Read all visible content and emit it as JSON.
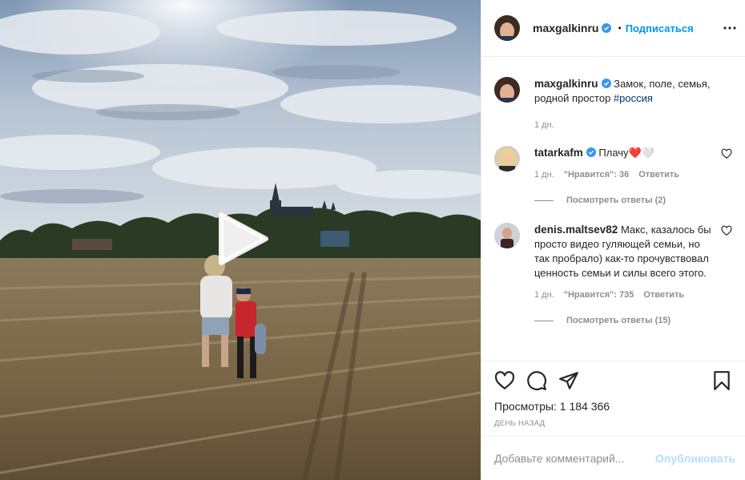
{
  "post": {
    "author": "maxgalkinru",
    "follow_label": "Подписаться",
    "dot": "•",
    "caption_text": "Замок, поле, семья, родной простор",
    "caption_hashtag": "#россия",
    "caption_age": "1 дн."
  },
  "comments": [
    {
      "user": "tatarkafm",
      "text": "Плачу❤️🤍",
      "age": "1 дн.",
      "likes_label": "\"Нравится\": 36",
      "reply_label": "Ответить",
      "view_replies": "Посмотреть ответы (2)"
    },
    {
      "user": "denis.maltsev82",
      "text": "Макс, казалось бы просто видео гуляющей семьи, но так пробрало) как-то прочувствовал ценность семьи и силы всего этого.",
      "age": "1 дн.",
      "likes_label": "\"Нравится\": 735",
      "reply_label": "Ответить",
      "view_replies": "Посмотреть ответы (15)"
    }
  ],
  "stats": {
    "views_label": "Просмотры: 1 184 366",
    "date": "ДЕНЬ НАЗАД"
  },
  "add_comment": {
    "placeholder": "Добавьте комментарий...",
    "publish_label": "Опубликовать"
  },
  "icons": {
    "like": "heart-icon",
    "comment": "speech-bubble-icon",
    "share": "paper-plane-icon",
    "save": "bookmark-icon",
    "more": "more-dots-icon",
    "verified": "verified-badge-icon",
    "play": "play-icon"
  },
  "colors": {
    "accent": "#0095f6",
    "verified": "#3897f0",
    "publish_disabled": "#b2dffc",
    "muted": "#8e8e8e",
    "hashtag": "#00376b"
  }
}
